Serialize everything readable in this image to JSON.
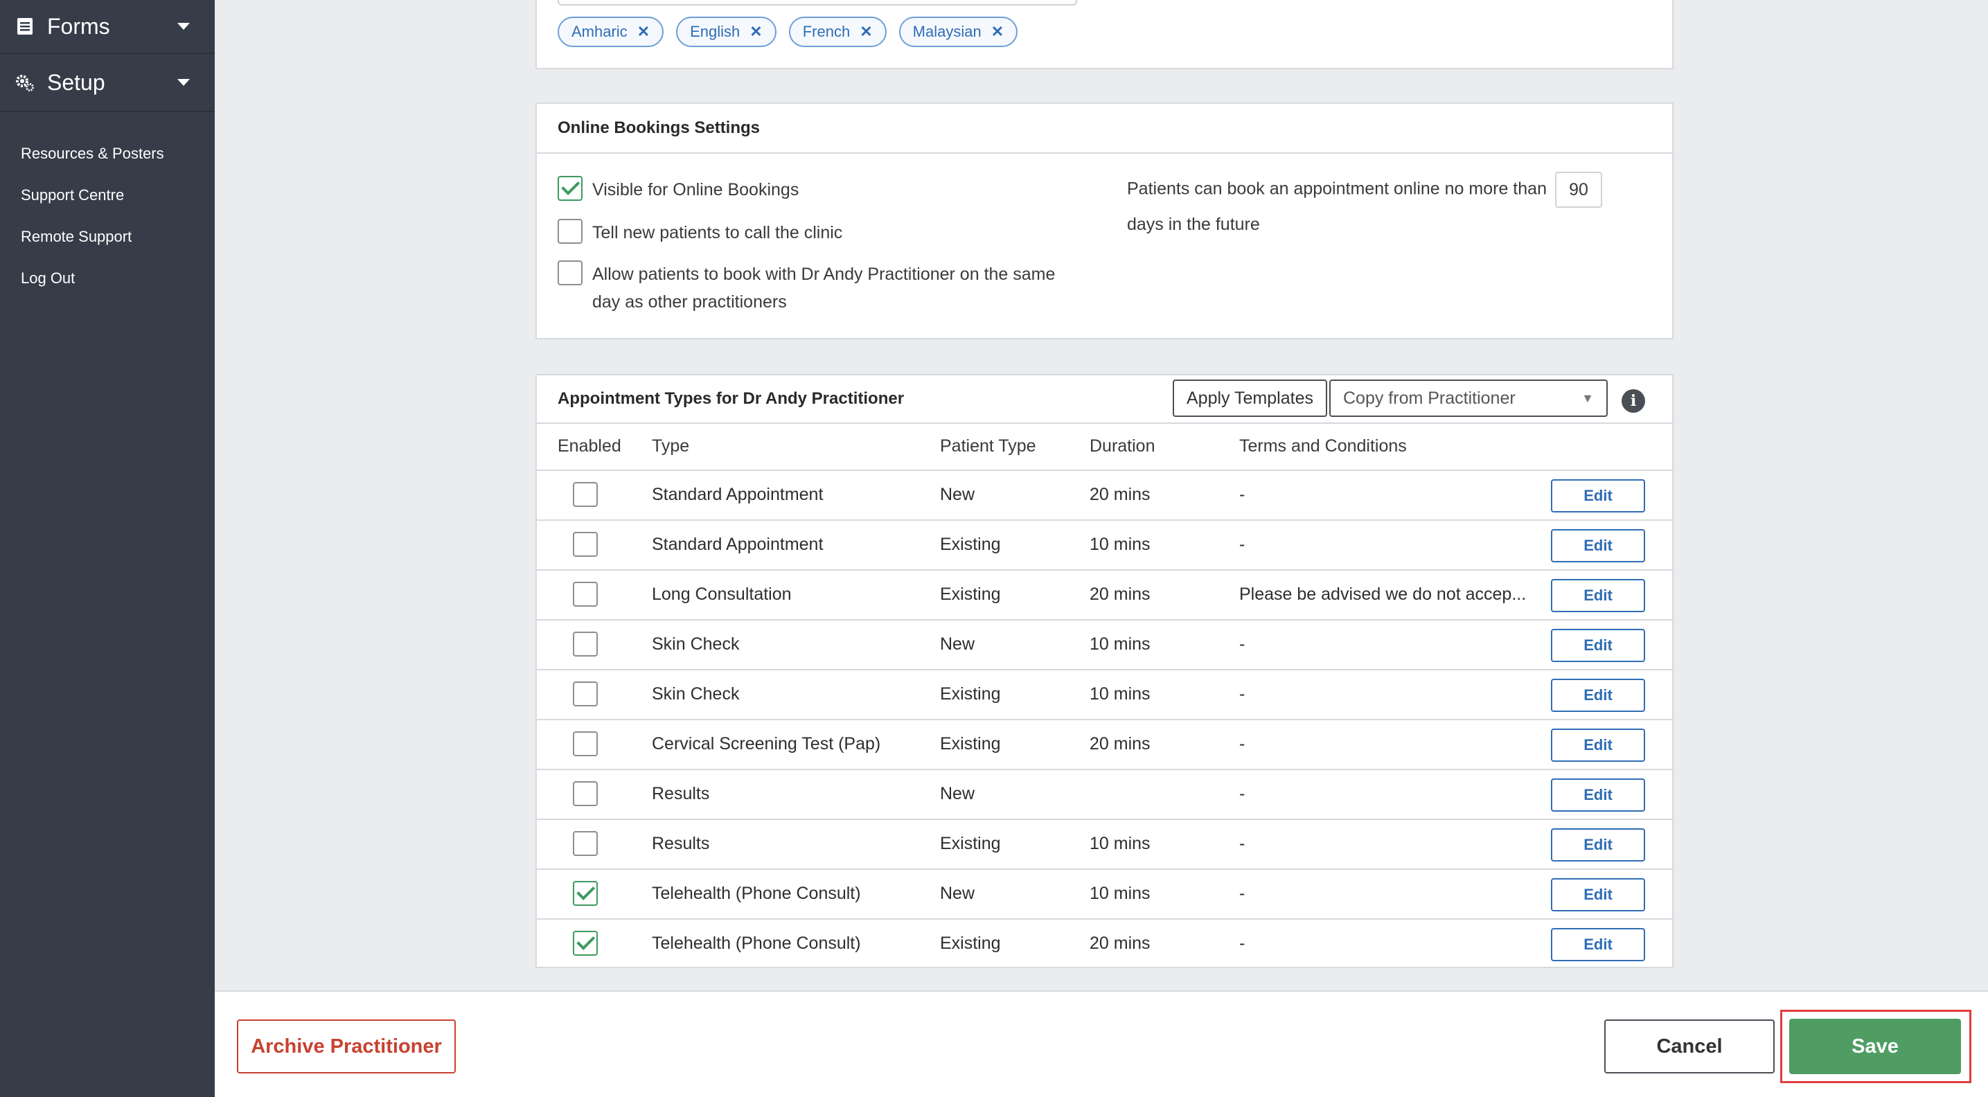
{
  "sidebar": {
    "forms_label": "Forms",
    "setup_label": "Setup",
    "links": [
      "Resources & Posters",
      "Support Centre",
      "Remote Support",
      "Log Out"
    ]
  },
  "languages": {
    "tags": [
      "Amharic",
      "English",
      "French",
      "Malaysian"
    ],
    "remove_glyph": "✕"
  },
  "online_bookings": {
    "title": "Online Bookings Settings",
    "visible_label": "Visible for Online Bookings",
    "visible_checked": true,
    "tell_new_label": "Tell new patients to call the clinic",
    "tell_new_checked": false,
    "allow_same_day_label": "Allow patients to book with Dr Andy Practitioner on the same day as other practitioners",
    "allow_same_day_checked": false,
    "advance_text_before": "Patients can book an appointment online no more than",
    "advance_days": "90",
    "advance_text_after": "days in the future"
  },
  "appointment_types": {
    "title": "Appointment Types for Dr Andy Practitioner",
    "apply_templates_label": "Apply Templates",
    "copy_from_placeholder": "Copy from Practitioner",
    "columns": [
      "Enabled",
      "Type",
      "Patient Type",
      "Duration",
      "Terms and Conditions"
    ],
    "edit_label": "Edit",
    "rows": [
      {
        "enabled": false,
        "type": "Standard Appointment",
        "patient_type": "New",
        "duration": "20 mins",
        "terms": "-"
      },
      {
        "enabled": false,
        "type": "Standard Appointment",
        "patient_type": "Existing",
        "duration": "10 mins",
        "terms": "-"
      },
      {
        "enabled": false,
        "type": "Long Consultation",
        "patient_type": "Existing",
        "duration": "20 mins",
        "terms": "Please be advised we do not accep..."
      },
      {
        "enabled": false,
        "type": "Skin Check",
        "patient_type": "New",
        "duration": "10 mins",
        "terms": "-"
      },
      {
        "enabled": false,
        "type": "Skin Check",
        "patient_type": "Existing",
        "duration": "10 mins",
        "terms": "-"
      },
      {
        "enabled": false,
        "type": "Cervical Screening Test (Pap)",
        "patient_type": "Existing",
        "duration": "20 mins",
        "terms": "-"
      },
      {
        "enabled": false,
        "type": "Results",
        "patient_type": "New",
        "duration": "",
        "terms": "-"
      },
      {
        "enabled": false,
        "type": "Results",
        "patient_type": "Existing",
        "duration": "10 mins",
        "terms": "-"
      },
      {
        "enabled": true,
        "type": "Telehealth (Phone Consult)",
        "patient_type": "New",
        "duration": "10 mins",
        "terms": "-"
      },
      {
        "enabled": true,
        "type": "Telehealth (Phone Consult)",
        "patient_type": "Existing",
        "duration": "20 mins",
        "terms": "-"
      }
    ]
  },
  "footer": {
    "archive_label": "Archive Practitioner",
    "cancel_label": "Cancel",
    "save_label": "Save"
  },
  "colors": {
    "sidebar_bg": "#363c48",
    "accent_blue": "#2f6db5",
    "save_green": "#4f9d63",
    "archive_red": "#c8412f",
    "highlight_red": "#e03c3c"
  }
}
